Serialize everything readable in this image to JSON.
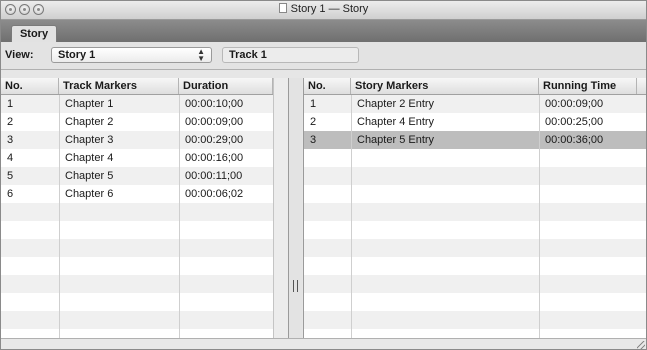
{
  "window": {
    "title": "Story 1 — Story"
  },
  "tabs": [
    {
      "label": "Story",
      "selected": true
    }
  ],
  "toolbar": {
    "view_label": "View:",
    "view_selected": "Story 1",
    "track_label": "Track 1"
  },
  "track_table": {
    "columns": [
      "No.",
      "Track Markers",
      "Duration"
    ],
    "rows": [
      [
        "1",
        "Chapter 1",
        "00:00:10;00"
      ],
      [
        "2",
        "Chapter 2",
        "00:00:09;00"
      ],
      [
        "3",
        "Chapter 3",
        "00:00:29;00"
      ],
      [
        "4",
        "Chapter 4",
        "00:00:16;00"
      ],
      [
        "5",
        "Chapter 5",
        "00:00:11;00"
      ],
      [
        "6",
        "Chapter 6",
        "00:00:06;02"
      ]
    ]
  },
  "story_table": {
    "columns": [
      "No.",
      "Story Markers",
      "Running Time"
    ],
    "rows": [
      [
        "1",
        "Chapter 2 Entry",
        "00:00:09;00"
      ],
      [
        "2",
        "Chapter 4 Entry",
        "00:00:25;00"
      ],
      [
        "3",
        "Chapter 5 Entry",
        "00:00:36;00"
      ]
    ],
    "selected_row": 3
  },
  "colors": {
    "tabbar": "#7a7a7a",
    "row_alt": "#f0f0f0",
    "row_selected": "#bdbdbd"
  }
}
